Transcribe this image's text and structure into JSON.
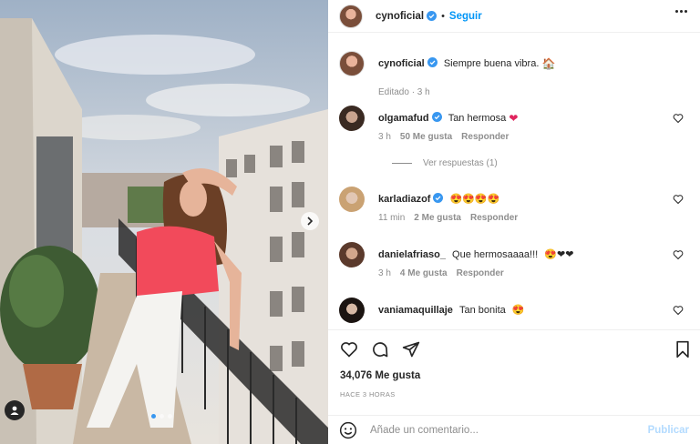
{
  "post": {
    "author": "cynoficial",
    "follow_label": "Seguir",
    "separator": "•",
    "caption": "Siempre buena vibra.",
    "caption_emoji": "🏠",
    "caption_meta": "Editado · 3 h",
    "likes": "34,076 Me gusta",
    "time_ago": "HACE 3 HORAS",
    "carousel": {
      "slides": 3,
      "current": 1
    }
  },
  "comments": [
    {
      "user": "olgamafud",
      "verified": true,
      "text": "Tan hermosa",
      "emoji": "❤",
      "time": "3 h",
      "likes": "50 Me gusta",
      "reply_label": "Responder",
      "replies": "Ver respuestas (1)"
    },
    {
      "user": "karladiazof",
      "verified": true,
      "text": "",
      "emoji": "😍😍😍😍",
      "time": "11 min",
      "likes": "2 Me gusta",
      "reply_label": "Responder"
    },
    {
      "user": "danielafriaso_",
      "verified": false,
      "text": "Que hermosaaaa!!!",
      "emoji": "😍❤❤",
      "time": "3 h",
      "likes": "4 Me gusta",
      "reply_label": "Responder"
    },
    {
      "user": "vaniamaquillaje",
      "verified": false,
      "text": "Tan bonita",
      "emoji": "😍",
      "time": "",
      "likes": "",
      "reply_label": ""
    }
  ],
  "composer": {
    "placeholder": "Añade un comentario...",
    "publish_label": "Publicar"
  },
  "colors": {
    "accent": "#0095f6",
    "verified": "#3897f0",
    "heart": "#ed4956"
  },
  "icons": [
    "more-options-icon",
    "verified-icon",
    "heart-icon",
    "comment-icon",
    "share-icon",
    "save-icon",
    "emoji-icon",
    "next-slide-icon",
    "user-tag-icon"
  ]
}
